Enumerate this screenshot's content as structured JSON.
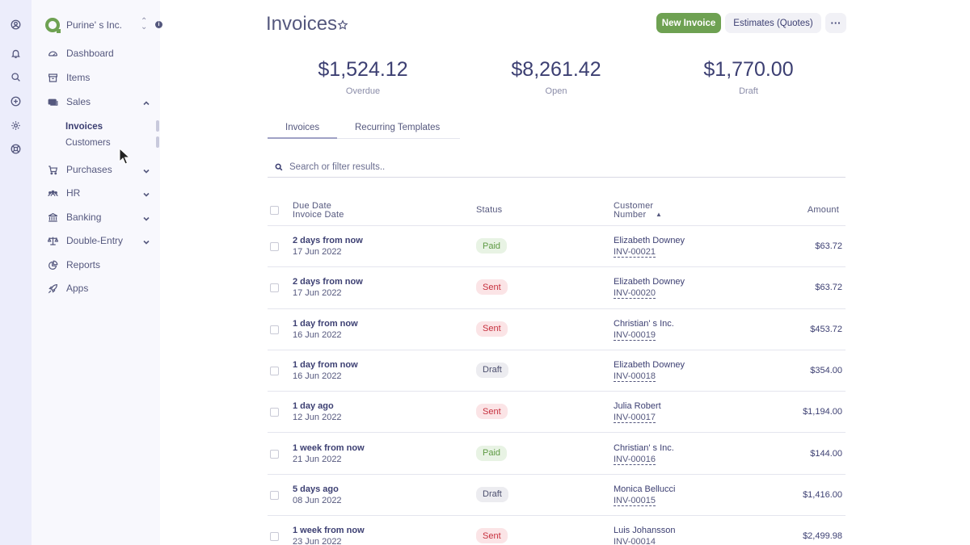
{
  "org": {
    "name": "Purine' s Inc."
  },
  "nav": {
    "dashboard": "Dashboard",
    "items": "Items",
    "sales": "Sales",
    "invoices": "Invoices",
    "customers": "Customers",
    "purchases": "Purchases",
    "hr": "HR",
    "banking": "Banking",
    "double_entry": "Double-Entry",
    "reports": "Reports",
    "apps": "Apps"
  },
  "header": {
    "title": "Invoices",
    "new_invoice": "New Invoice",
    "estimates": "Estimates (Quotes)",
    "more": "···"
  },
  "summary": [
    {
      "amount": "$1,524.12",
      "label": "Overdue"
    },
    {
      "amount": "$8,261.42",
      "label": "Open"
    },
    {
      "amount": "$1,770.00",
      "label": "Draft"
    }
  ],
  "tabs": [
    "Invoices",
    "Recurring Templates"
  ],
  "search": {
    "placeholder": "Search or filter results.."
  },
  "table": {
    "headers": {
      "due_date": "Due Date",
      "invoice_date": "Invoice Date",
      "status": "Status",
      "customer": "Customer",
      "number": "Number",
      "amount": "Amount"
    },
    "rows": [
      {
        "due": "2 days from now",
        "date": "17 Jun 2022",
        "status": "Paid",
        "customer": "Elizabeth Downey",
        "number": "INV-00021",
        "amount": "$63.72"
      },
      {
        "due": "2 days from now",
        "date": "17 Jun 2022",
        "status": "Sent",
        "customer": "Elizabeth Downey",
        "number": "INV-00020",
        "amount": "$63.72"
      },
      {
        "due": "1 day from now",
        "date": "16 Jun 2022",
        "status": "Sent",
        "customer": "Christian' s Inc.",
        "number": "INV-00019",
        "amount": "$453.72"
      },
      {
        "due": "1 day from now",
        "date": "16 Jun 2022",
        "status": "Draft",
        "customer": "Elizabeth Downey",
        "number": "INV-00018",
        "amount": "$354.00"
      },
      {
        "due": "1 day ago",
        "date": "12 Jun 2022",
        "status": "Sent",
        "customer": "Julia Robert",
        "number": "INV-00017",
        "amount": "$1,194.00"
      },
      {
        "due": "1 week from now",
        "date": "21 Jun 2022",
        "status": "Paid",
        "customer": "Christian' s Inc.",
        "number": "INV-00016",
        "amount": "$144.00"
      },
      {
        "due": "5 days ago",
        "date": "08 Jun 2022",
        "status": "Draft",
        "customer": "Monica Bellucci",
        "number": "INV-00015",
        "amount": "$1,416.00"
      },
      {
        "due": "1 week from now",
        "date": "23 Jun 2022",
        "status": "Sent",
        "customer": "Luis Johansson",
        "number": "INV-00014",
        "amount": "$2,499.98"
      }
    ]
  }
}
